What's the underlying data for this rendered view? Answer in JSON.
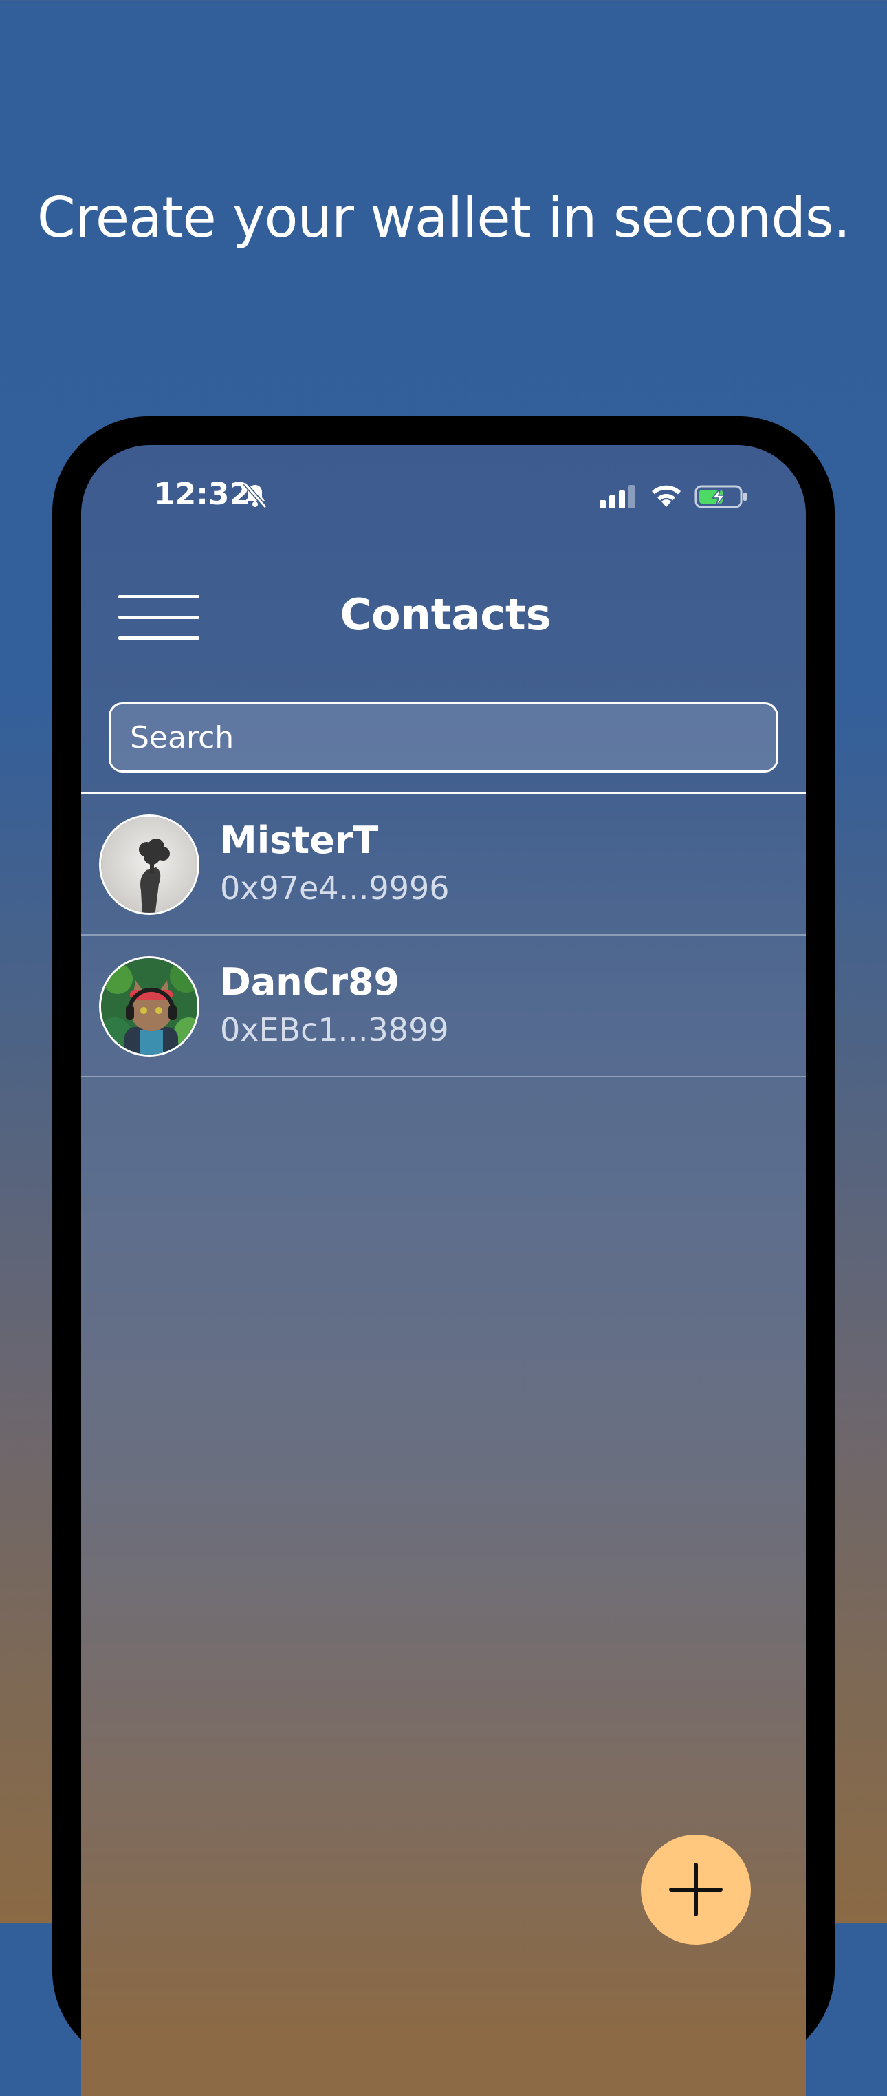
{
  "headline": "Create your wallet in seconds.",
  "status_bar": {
    "time": "12:32",
    "icons": [
      "bell-slash-icon",
      "signal-icon",
      "wifi-icon",
      "battery-charging-icon"
    ]
  },
  "header": {
    "title": "Contacts",
    "menu_icon": "hamburger-menu-icon"
  },
  "search": {
    "placeholder": "Search",
    "value": ""
  },
  "contacts": [
    {
      "name": "MisterT",
      "address": "0x97e4...9996",
      "avatar": "avatar-mistert"
    },
    {
      "name": "DanCr89",
      "address": "0xEBc1...3899",
      "avatar": "avatar-dancr89"
    }
  ],
  "fab": {
    "icon": "plus-icon"
  },
  "colors": {
    "background_top": "#325e99",
    "background_bottom": "#8b6a45",
    "fab": "#ffc87e",
    "text": "#ffffff"
  }
}
